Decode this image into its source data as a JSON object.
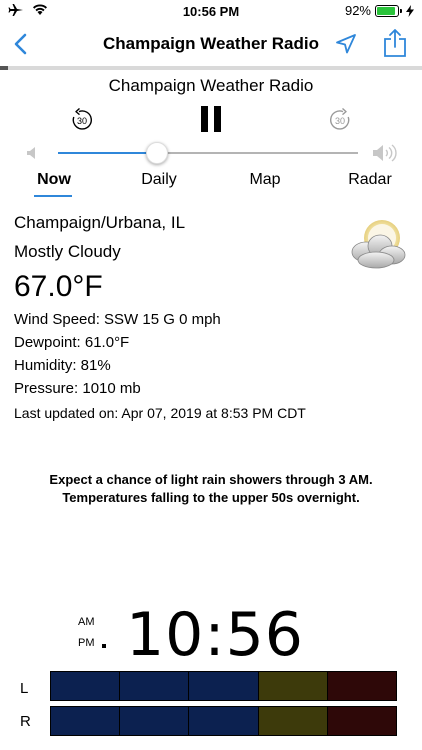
{
  "status": {
    "time": "10:56 PM",
    "battery_text": "92%",
    "battery_level": 0.92,
    "battery_color": "#2ac33b"
  },
  "nav": {
    "title": "Champaign Weather Radio",
    "back_icon": "chevron-left-icon",
    "location_icon": "location-arrow-icon",
    "share_icon": "share-icon"
  },
  "player": {
    "title": "Champaign Weather Radio",
    "skip_back_label": "30",
    "skip_forward_label": "30",
    "volume_level": 0.33,
    "accent_color": "#2f87da"
  },
  "tabs": [
    {
      "label": "Now",
      "active": true
    },
    {
      "label": "Daily",
      "active": false
    },
    {
      "label": "Map",
      "active": false
    },
    {
      "label": "Radar",
      "active": false
    }
  ],
  "weather": {
    "location": "Champaign/Urbana, IL",
    "condition": "Mostly Cloudy",
    "temperature": "67.0°F",
    "wind": "Wind Speed: SSW 15 G 0 mph",
    "dewpoint": "Dewpoint: 61.0°F",
    "humidity": "Humidity: 81%",
    "pressure": "Pressure: 1010 mb",
    "updated": "Last updated on: Apr 07, 2019 at 8:53 PM CDT",
    "icon": "mostly-cloudy-icon"
  },
  "forecast": {
    "line1": "Expect a chance of light rain showers through 3 AM.",
    "line2": "Temperatures falling to the upper 50s overnight."
  },
  "clock": {
    "am": "AM",
    "pm": "PM",
    "time": "10:56"
  },
  "meters": {
    "left_label": "L",
    "right_label": "R",
    "segment_colors": [
      "#0c2150",
      "#0c2150",
      "#0c2150",
      "#3d3a0b",
      "#2e0808"
    ]
  }
}
